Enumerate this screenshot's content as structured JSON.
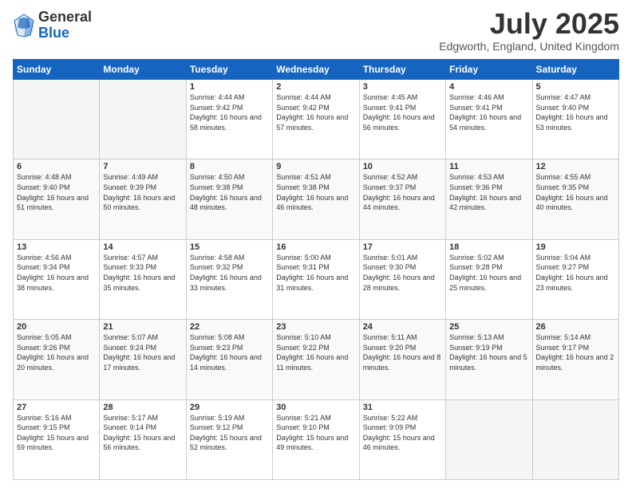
{
  "header": {
    "logo_line1": "General",
    "logo_line2": "Blue",
    "title": "July 2025",
    "subtitle": "Edgworth, England, United Kingdom"
  },
  "days_of_week": [
    "Sunday",
    "Monday",
    "Tuesday",
    "Wednesday",
    "Thursday",
    "Friday",
    "Saturday"
  ],
  "weeks": [
    [
      {
        "day": "",
        "info": ""
      },
      {
        "day": "",
        "info": ""
      },
      {
        "day": "1",
        "info": "Sunrise: 4:44 AM\nSunset: 9:42 PM\nDaylight: 16 hours and 58 minutes."
      },
      {
        "day": "2",
        "info": "Sunrise: 4:44 AM\nSunset: 9:42 PM\nDaylight: 16 hours and 57 minutes."
      },
      {
        "day": "3",
        "info": "Sunrise: 4:45 AM\nSunset: 9:41 PM\nDaylight: 16 hours and 56 minutes."
      },
      {
        "day": "4",
        "info": "Sunrise: 4:46 AM\nSunset: 9:41 PM\nDaylight: 16 hours and 54 minutes."
      },
      {
        "day": "5",
        "info": "Sunrise: 4:47 AM\nSunset: 9:40 PM\nDaylight: 16 hours and 53 minutes."
      }
    ],
    [
      {
        "day": "6",
        "info": "Sunrise: 4:48 AM\nSunset: 9:40 PM\nDaylight: 16 hours and 51 minutes."
      },
      {
        "day": "7",
        "info": "Sunrise: 4:49 AM\nSunset: 9:39 PM\nDaylight: 16 hours and 50 minutes."
      },
      {
        "day": "8",
        "info": "Sunrise: 4:50 AM\nSunset: 9:38 PM\nDaylight: 16 hours and 48 minutes."
      },
      {
        "day": "9",
        "info": "Sunrise: 4:51 AM\nSunset: 9:38 PM\nDaylight: 16 hours and 46 minutes."
      },
      {
        "day": "10",
        "info": "Sunrise: 4:52 AM\nSunset: 9:37 PM\nDaylight: 16 hours and 44 minutes."
      },
      {
        "day": "11",
        "info": "Sunrise: 4:53 AM\nSunset: 9:36 PM\nDaylight: 16 hours and 42 minutes."
      },
      {
        "day": "12",
        "info": "Sunrise: 4:55 AM\nSunset: 9:35 PM\nDaylight: 16 hours and 40 minutes."
      }
    ],
    [
      {
        "day": "13",
        "info": "Sunrise: 4:56 AM\nSunset: 9:34 PM\nDaylight: 16 hours and 38 minutes."
      },
      {
        "day": "14",
        "info": "Sunrise: 4:57 AM\nSunset: 9:33 PM\nDaylight: 16 hours and 35 minutes."
      },
      {
        "day": "15",
        "info": "Sunrise: 4:58 AM\nSunset: 9:32 PM\nDaylight: 16 hours and 33 minutes."
      },
      {
        "day": "16",
        "info": "Sunrise: 5:00 AM\nSunset: 9:31 PM\nDaylight: 16 hours and 31 minutes."
      },
      {
        "day": "17",
        "info": "Sunrise: 5:01 AM\nSunset: 9:30 PM\nDaylight: 16 hours and 28 minutes."
      },
      {
        "day": "18",
        "info": "Sunrise: 5:02 AM\nSunset: 9:28 PM\nDaylight: 16 hours and 25 minutes."
      },
      {
        "day": "19",
        "info": "Sunrise: 5:04 AM\nSunset: 9:27 PM\nDaylight: 16 hours and 23 minutes."
      }
    ],
    [
      {
        "day": "20",
        "info": "Sunrise: 5:05 AM\nSunset: 9:26 PM\nDaylight: 16 hours and 20 minutes."
      },
      {
        "day": "21",
        "info": "Sunrise: 5:07 AM\nSunset: 9:24 PM\nDaylight: 16 hours and 17 minutes."
      },
      {
        "day": "22",
        "info": "Sunrise: 5:08 AM\nSunset: 9:23 PM\nDaylight: 16 hours and 14 minutes."
      },
      {
        "day": "23",
        "info": "Sunrise: 5:10 AM\nSunset: 9:22 PM\nDaylight: 16 hours and 11 minutes."
      },
      {
        "day": "24",
        "info": "Sunrise: 5:11 AM\nSunset: 9:20 PM\nDaylight: 16 hours and 8 minutes."
      },
      {
        "day": "25",
        "info": "Sunrise: 5:13 AM\nSunset: 9:19 PM\nDaylight: 16 hours and 5 minutes."
      },
      {
        "day": "26",
        "info": "Sunrise: 5:14 AM\nSunset: 9:17 PM\nDaylight: 16 hours and 2 minutes."
      }
    ],
    [
      {
        "day": "27",
        "info": "Sunrise: 5:16 AM\nSunset: 9:15 PM\nDaylight: 15 hours and 59 minutes."
      },
      {
        "day": "28",
        "info": "Sunrise: 5:17 AM\nSunset: 9:14 PM\nDaylight: 15 hours and 56 minutes."
      },
      {
        "day": "29",
        "info": "Sunrise: 5:19 AM\nSunset: 9:12 PM\nDaylight: 15 hours and 52 minutes."
      },
      {
        "day": "30",
        "info": "Sunrise: 5:21 AM\nSunset: 9:10 PM\nDaylight: 15 hours and 49 minutes."
      },
      {
        "day": "31",
        "info": "Sunrise: 5:22 AM\nSunset: 9:09 PM\nDaylight: 15 hours and 46 minutes."
      },
      {
        "day": "",
        "info": ""
      },
      {
        "day": "",
        "info": ""
      }
    ]
  ]
}
